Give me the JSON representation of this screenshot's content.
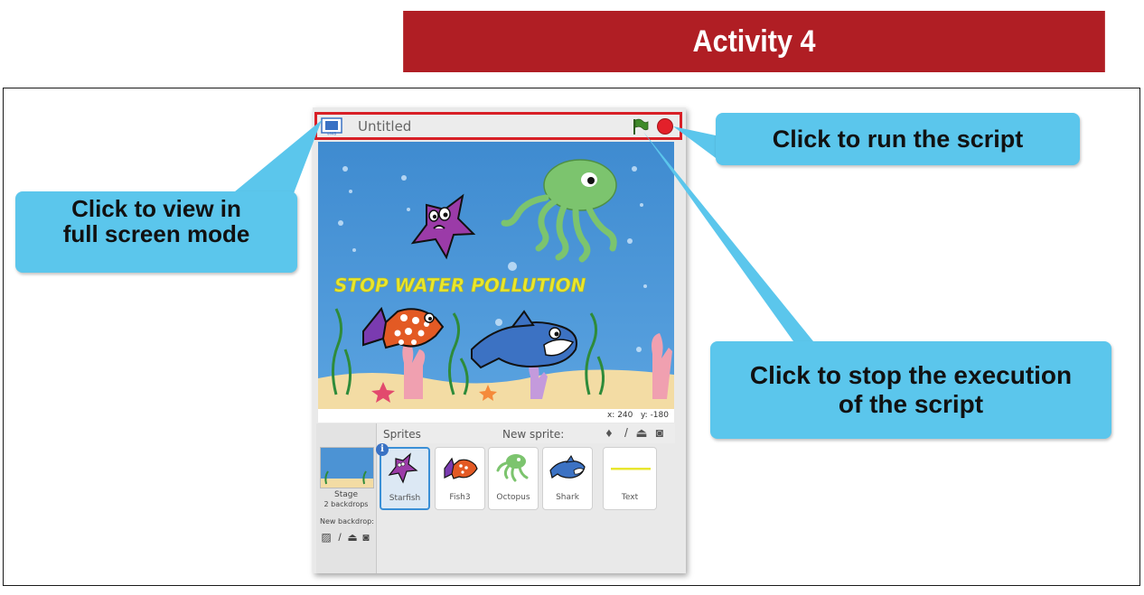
{
  "banner": {
    "title": "Activity 4"
  },
  "scratch": {
    "project_title": "Untitled",
    "stage_banner": "STOP WATER POLLUTION",
    "coords": {
      "x_label": "x:",
      "x": "240",
      "y_label": "y:",
      "y": "-180"
    },
    "sprites_label": "Sprites",
    "new_sprite_label": "New sprite:",
    "stage_name": "Stage",
    "stage_backdrops": "2 backdrops",
    "new_backdrop_label": "New backdrop:",
    "sprites": [
      {
        "name": "Starfish",
        "selected": true,
        "icon": "starfish-icon"
      },
      {
        "name": "Fish3",
        "selected": false,
        "icon": "fish-icon"
      },
      {
        "name": "Octopus",
        "selected": false,
        "icon": "octopus-icon"
      },
      {
        "name": "Shark",
        "selected": false,
        "icon": "shark-icon"
      },
      {
        "name": "Text",
        "selected": false,
        "icon": "text-sprite-icon"
      }
    ],
    "colors": {
      "stop": "#e3202a",
      "flag": "#3f8a2a",
      "highlight": "#d82027",
      "stage_water": "#4a92d3",
      "selection": "#3a8fd6"
    }
  },
  "callouts": {
    "fullscreen_line1": "Click to view in",
    "fullscreen_line2": "full screen mode",
    "run": "Click to run the script",
    "stop_line1": "Click to stop the execution",
    "stop_line2": "of the script"
  },
  "colors": {
    "banner": "#b01e24",
    "callout": "#5bc6ec"
  }
}
